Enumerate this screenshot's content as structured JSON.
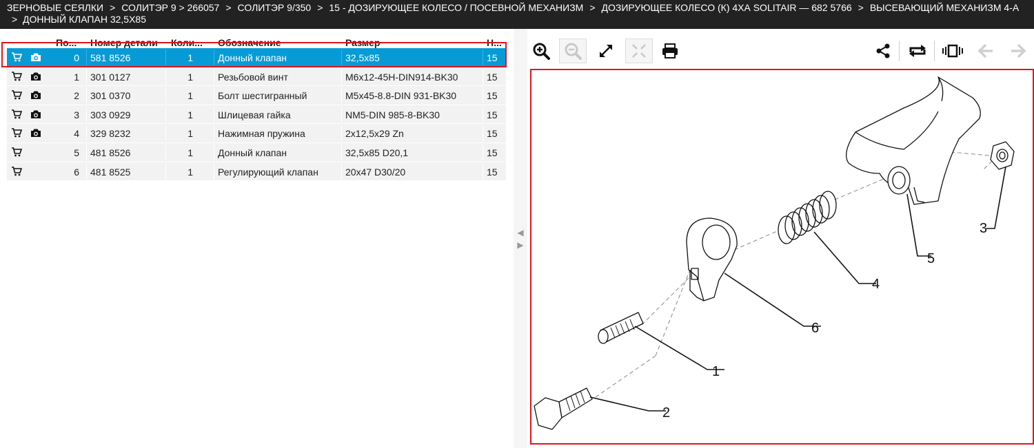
{
  "breadcrumb": {
    "items": [
      "ЗЕРНОВЫЕ СЕЯЛКИ",
      "СОЛИТЭР 9 > 266057",
      "СОЛИТЭР 9/350",
      "15 - ДОЗИРУЮЩЕЕ КОЛЕСО / ПОСЕВНОЙ МЕХАНИЗМ",
      "ДОЗИРУЮЩЕЕ КОЛЕСО (К) 4ХА SOLITAIR — 682 5766",
      "ВЫСЕВАЮЩИЙ МЕХАНИЗМ 4-А",
      "ДОННЫЙ КЛАПАН 32,5Х85"
    ],
    "separator": ">"
  },
  "table": {
    "headers": {
      "pos": "По...",
      "part_number": "Номер детали",
      "qty": "Коли...",
      "designation": "Обозначение",
      "size": "Размер",
      "page": "Н..."
    },
    "rows": [
      {
        "pos": "0",
        "part_number": "581 8526",
        "qty": "1",
        "designation": "Донный клапан",
        "size": "32,5x85",
        "page": "15",
        "has_image": true,
        "selected": true
      },
      {
        "pos": "1",
        "part_number": "301 0127",
        "qty": "1",
        "designation": "Резьбовой винт",
        "size": "M6x12-45H-DIN914-BK30",
        "page": "15",
        "has_image": true,
        "selected": false
      },
      {
        "pos": "2",
        "part_number": "301 0370",
        "qty": "1",
        "designation": "Болт шестигранный",
        "size": "M5x45-8.8-DIN 931-BK30",
        "page": "15",
        "has_image": true,
        "selected": false
      },
      {
        "pos": "3",
        "part_number": "303 0929",
        "qty": "1",
        "designation": "Шлицевая гайка",
        "size": "NM5-DIN 985-8-BK30",
        "page": "15",
        "has_image": true,
        "selected": false
      },
      {
        "pos": "4",
        "part_number": "329 8232",
        "qty": "1",
        "designation": "Нажимная пружина",
        "size": "2x12,5x29 Zn",
        "page": "15",
        "has_image": true,
        "selected": false
      },
      {
        "pos": "5",
        "part_number": "481 8526",
        "qty": "1",
        "designation": "Донный клапан",
        "size": "32,5x85 D20,1",
        "page": "15",
        "has_image": false,
        "selected": false
      },
      {
        "pos": "6",
        "part_number": "481 8525",
        "qty": "1",
        "designation": "Регулирующий клапан",
        "size": "20x47 D30/20",
        "page": "15",
        "has_image": false,
        "selected": false
      }
    ]
  },
  "toolbar": {
    "left": [
      "zoom-in-icon",
      "zoom-out-icon",
      "fullscreen-icon",
      "fit-icon",
      "print-icon"
    ],
    "right": [
      "share-icon",
      "repeat-icon",
      "carousel-icon",
      "arrow-left-icon",
      "arrow-right-icon"
    ]
  },
  "drawing": {
    "callouts": [
      "1",
      "2",
      "3",
      "4",
      "5",
      "6"
    ]
  },
  "colors": {
    "header_bg": "#222222",
    "selected_row": "#069bd6",
    "row_bg": "#f2f2f2",
    "highlight_border": "#e3131b"
  }
}
